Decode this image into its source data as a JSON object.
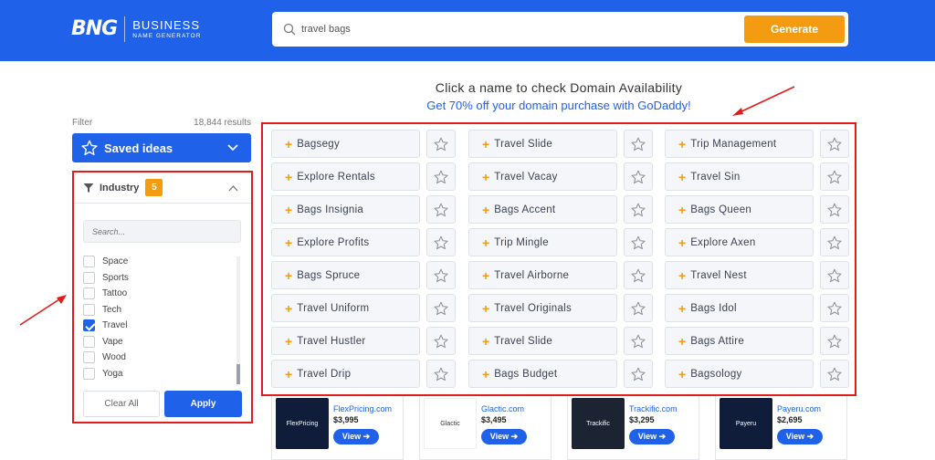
{
  "logo": {
    "mark": "BNG",
    "line1": "BUSINESS",
    "line2": "NAME GENERATOR"
  },
  "search": {
    "value": "travel bags",
    "button": "Generate"
  },
  "heading": "Click a name to check Domain Availability",
  "promo": "Get 70% off your domain purchase with GoDaddy!",
  "filter": {
    "label": "Filter",
    "results": "18,844 results"
  },
  "saved": {
    "label": "Saved ideas"
  },
  "industry": {
    "title": "Industry",
    "count": "5",
    "search_placeholder": "Search...",
    "items": [
      {
        "label": "Space",
        "checked": false
      },
      {
        "label": "Sports",
        "checked": false
      },
      {
        "label": "Tattoo",
        "checked": false
      },
      {
        "label": "Tech",
        "checked": false
      },
      {
        "label": "Travel",
        "checked": true
      },
      {
        "label": "Vape",
        "checked": false
      },
      {
        "label": "Wood",
        "checked": false
      },
      {
        "label": "Yoga",
        "checked": false
      }
    ],
    "clear": "Clear All",
    "apply": "Apply"
  },
  "names": {
    "col1": [
      "Bagsegy",
      "Explore Rentals",
      "Bags Insignia",
      "Explore Profits",
      "Bags Spruce",
      "Travel Uniform",
      "Travel Hustler",
      "Travel Drip"
    ],
    "col2": [
      "Travel Slide",
      "Travel Vacay",
      "Bags Accent",
      "Trip Mingle",
      "Travel Airborne",
      "Travel Originals",
      "Travel Slide",
      "Bags Budget"
    ],
    "col3": [
      "Trip Management",
      "Travel Sin",
      "Bags Queen",
      "Explore Axen",
      "Travel Nest",
      "Bags Idol",
      "Bags Attire",
      "Bagsology"
    ]
  },
  "ads": [
    {
      "domain": "FlexPricing.com",
      "price": "$3,995",
      "logo": "FlexPricing",
      "bg": "#0f1c3a",
      "fg": "#ffffff",
      "view": "View ➔"
    },
    {
      "domain": "Glactic.com",
      "price": "$3,495",
      "logo": "Glactic",
      "bg": "#ffffff",
      "fg": "#333333",
      "view": "View ➔"
    },
    {
      "domain": "Trackific.com",
      "price": "$3,295",
      "logo": "Trackific",
      "bg": "#1c2433",
      "fg": "#ffffff",
      "view": "View ➔"
    },
    {
      "domain": "Payeru.com",
      "price": "$2,695",
      "logo": "Payeru",
      "bg": "#0f1c3a",
      "fg": "#ffffff",
      "view": "View ➔"
    }
  ],
  "colors": {
    "brand": "#1f62e9",
    "accent": "#f39c12",
    "highlight": "#e21b1b"
  }
}
